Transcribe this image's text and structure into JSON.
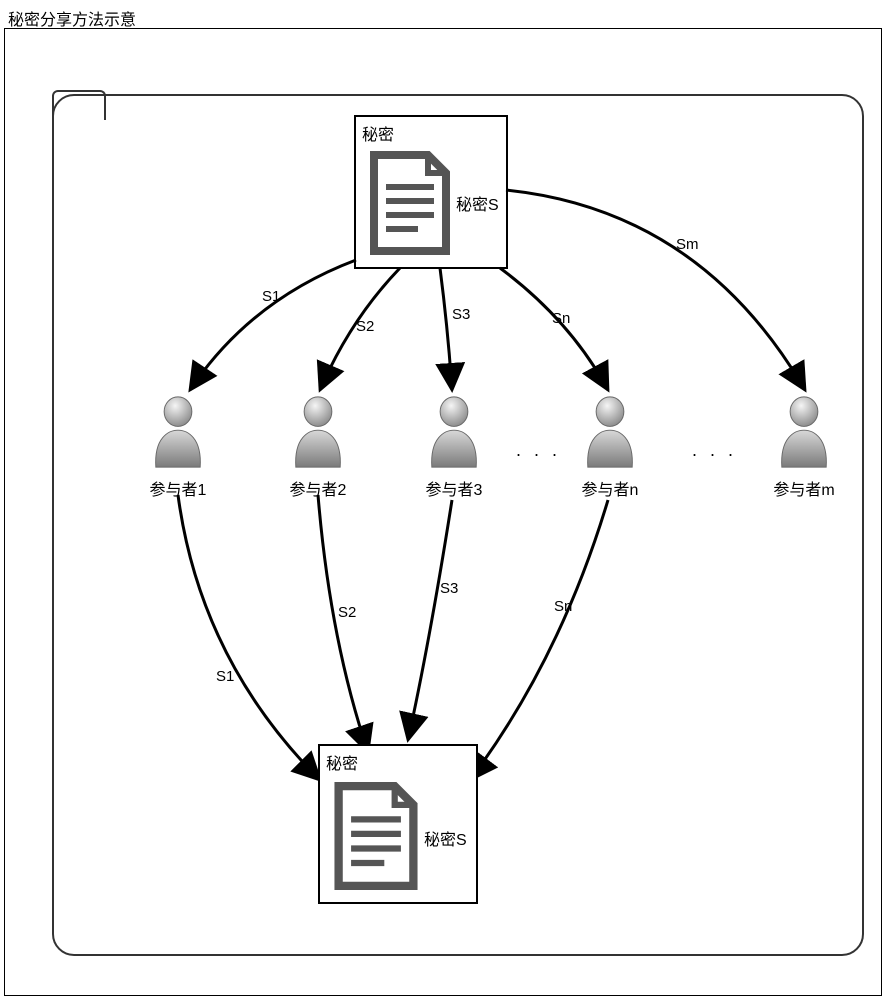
{
  "title": "秘密分享方法示意",
  "secret_top": {
    "header": "秘密",
    "caption": "秘密S"
  },
  "secret_bottom": {
    "header": "秘密",
    "caption": "秘密S"
  },
  "participants": [
    {
      "label": "参与者1"
    },
    {
      "label": "参与者2"
    },
    {
      "label": "参与者3"
    },
    {
      "label": "参与者n"
    },
    {
      "label": "参与者m"
    }
  ],
  "ellipsis": ". . .",
  "shares_down": [
    "S1",
    "S2",
    "S3",
    "Sn",
    "Sm"
  ],
  "shares_up": [
    "S1",
    "S2",
    "S3",
    "Sn"
  ]
}
